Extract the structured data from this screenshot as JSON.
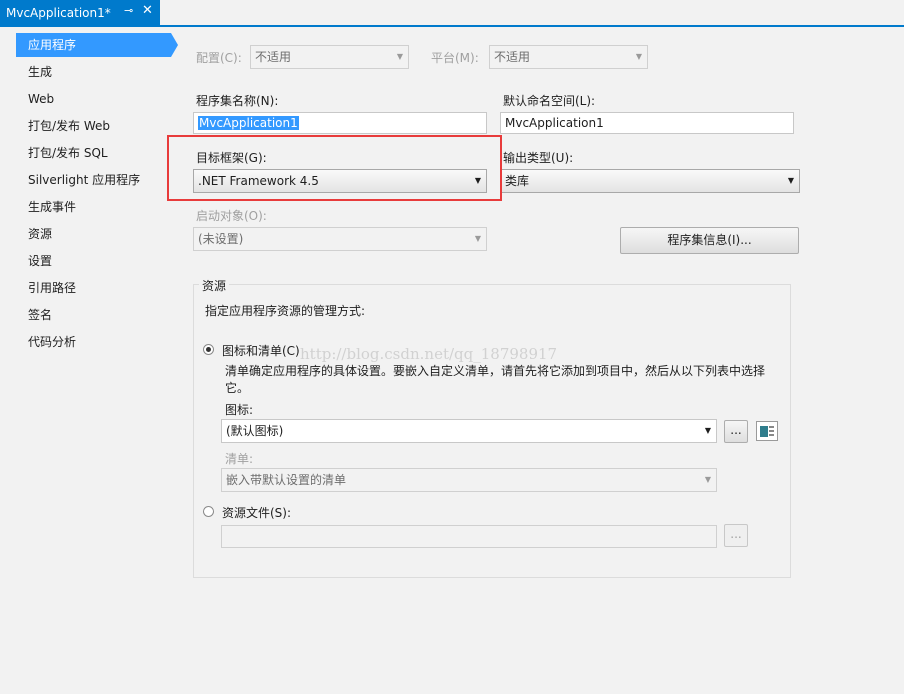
{
  "tab": {
    "title": "MvcApplication1*",
    "pin_icon": "pin-icon",
    "close_icon": "close-icon"
  },
  "sidebar": {
    "items": [
      {
        "label": "应用程序",
        "active": true
      },
      {
        "label": "生成"
      },
      {
        "label": "Web"
      },
      {
        "label": "打包/发布 Web"
      },
      {
        "label": "打包/发布 SQL"
      },
      {
        "label": "Silverlight 应用程序"
      },
      {
        "label": "生成事件"
      },
      {
        "label": "资源"
      },
      {
        "label": "设置"
      },
      {
        "label": "引用路径"
      },
      {
        "label": "签名"
      },
      {
        "label": "代码分析"
      }
    ]
  },
  "config": {
    "config_label": "配置(C):",
    "config_value": "不适用",
    "platform_label": "平台(M):",
    "platform_value": "不适用"
  },
  "assembly": {
    "name_label": "程序集名称(N):",
    "name_value": "MvcApplication1",
    "namespace_label": "默认命名空间(L):",
    "namespace_value": "MvcApplication1"
  },
  "framework": {
    "label": "目标框架(G):",
    "value": ".NET Framework 4.5"
  },
  "output": {
    "label": "输出类型(U):",
    "value": "类库"
  },
  "startup": {
    "label": "启动对象(O):",
    "value": "(未设置)"
  },
  "assembly_info_button": "程序集信息(I)...",
  "resources": {
    "group_title": "资源",
    "description": "指定应用程序资源的管理方式:",
    "icon_manifest_radio": "图标和清单(C)",
    "icon_manifest_help_line1": "清单确定应用程序的具体设置。要嵌入自定义清单，请首先将它添加到项目中，然后从以下列表中选择",
    "icon_manifest_help_line2": "它。",
    "icon_label": "图标:",
    "icon_value": "(默认图标)",
    "browse": "...",
    "manifest_label": "清单:",
    "manifest_value": "嵌入带默认设置的清单",
    "resource_file_radio": "资源文件(S):",
    "resource_file_value": ""
  },
  "watermark": "http://blog.csdn.net/qq_18798917",
  "colors": {
    "accent": "#007acc",
    "selection": "#3399ff",
    "highlight_box": "#e83b3b"
  }
}
